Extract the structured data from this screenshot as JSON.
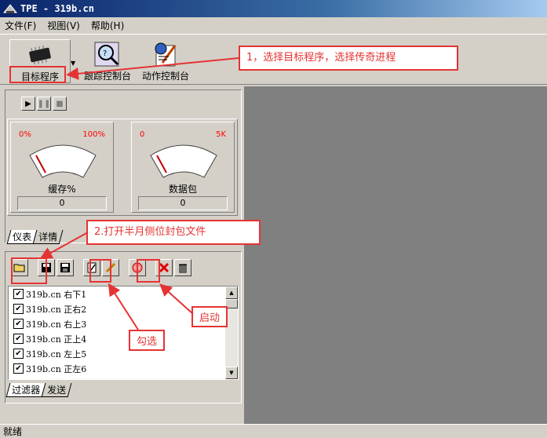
{
  "window": {
    "title": "TPE - 319b.cn"
  },
  "menu": [
    "文件(F)",
    "视图(V)",
    "帮助(H)"
  ],
  "toolbar": {
    "target": "目标程序",
    "trace": "跟踪控制台",
    "action": "动作控制台"
  },
  "gauges": [
    {
      "title": "缓存%",
      "min": "0%",
      "max": "100%",
      "value": "0"
    },
    {
      "title": "数据包",
      "min": "0",
      "max": "5K",
      "value": "0"
    }
  ],
  "top_tabs": [
    "仪表",
    "详情"
  ],
  "bottom_tabs": [
    "过滤器",
    "发送"
  ],
  "filters": [
    {
      "name": "319b.cn 右下1",
      "checked": true
    },
    {
      "name": "319b.cn 正右2",
      "checked": true
    },
    {
      "name": "319b.cn 右上3",
      "checked": true
    },
    {
      "name": "319b.cn 正上4",
      "checked": true
    },
    {
      "name": "319b.cn 左上5",
      "checked": true
    },
    {
      "name": "319b.cn 正左6",
      "checked": true
    }
  ],
  "status": "就绪",
  "annotations": {
    "step1": "1，选择目标程序，选择传奇进程",
    "step2": "2.打开半月侧位封包文件",
    "check": "勾选",
    "start": "启动"
  },
  "colors": {
    "annotation": "#e53333",
    "titlebar": "#0a246a"
  }
}
